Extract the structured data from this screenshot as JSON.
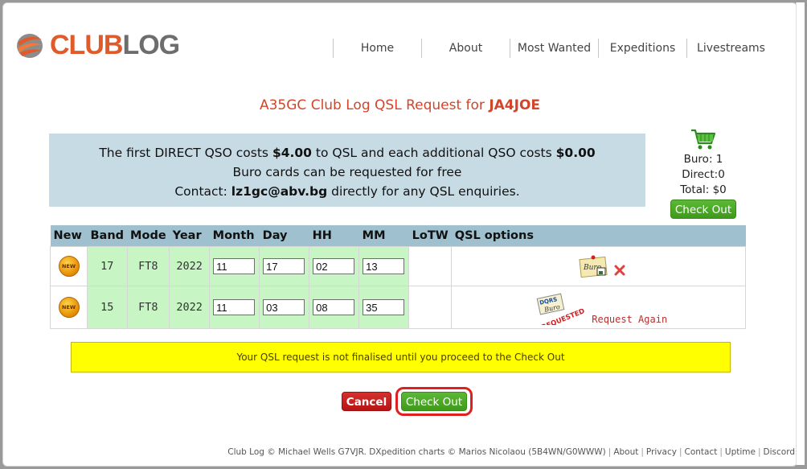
{
  "brand": {
    "name_part1": "CLUB",
    "name_part2": "LOG"
  },
  "nav": [
    {
      "label": "Home"
    },
    {
      "label": "About"
    },
    {
      "label": "Most Wanted"
    },
    {
      "label": "Expeditions"
    },
    {
      "label": "Livestreams"
    }
  ],
  "title": {
    "prefix": "A35GC Club Log QSL Request for ",
    "callsign": "JA4JOE"
  },
  "info": {
    "line1_a": "The first DIRECT QSO costs ",
    "line1_price1": "$4.00",
    "line1_b": " to QSL and each additional QSO costs ",
    "line1_price2": "$0.00",
    "line2": "Buro cards can be requested for free",
    "line3_a": "Contact: ",
    "line3_email": "lz1gc@abv.bg",
    "line3_b": " directly for any QSL enquiries."
  },
  "cart": {
    "buro": "Buro: 1",
    "direct": "Direct:0",
    "total": "Total: $0",
    "checkout_label": "Check Out"
  },
  "table": {
    "headers": [
      "New",
      "Band",
      "Mode",
      "Year",
      "Month",
      "Day",
      "HH",
      "MM",
      "LoTW",
      "QSL options"
    ],
    "rows": [
      {
        "badge": "NEW",
        "band": "17",
        "mode": "FT8",
        "year": "2022",
        "month": "11",
        "day": "17",
        "hh": "02",
        "mm": "13"
      },
      {
        "badge": "NEW",
        "band": "15",
        "mode": "FT8",
        "year": "2022",
        "month": "11",
        "day": "03",
        "hh": "08",
        "mm": "35",
        "request_again": "Request Again"
      }
    ],
    "buro_label": "Buro",
    "stamp_dqrs": "DQRS",
    "stamp_buro": "Buro",
    "stamp_requested": "REQUESTED"
  },
  "notice": "Your QSL request is not finalised until you proceed to the Check Out",
  "actions": {
    "cancel_label": "Cancel",
    "checkout_label": "Check Out"
  },
  "footer": {
    "credit": "Club Log © Michael Wells G7VJR. DXpedition charts © Marios Nicolaou (5B4WN/G0WWW)",
    "links": [
      "About",
      "Privacy",
      "Contact",
      "Uptime",
      "Discord"
    ]
  },
  "colors": {
    "brand_orange": "#e05a2a",
    "title_red": "#d2452a",
    "info_bg": "#c7dbe5",
    "header_bg": "#9ec0cf",
    "row_green": "#c8f5c4",
    "notice_yellow": "#ffff00",
    "checkout_green": "#4caa26",
    "cancel_red": "#c81e1e"
  }
}
